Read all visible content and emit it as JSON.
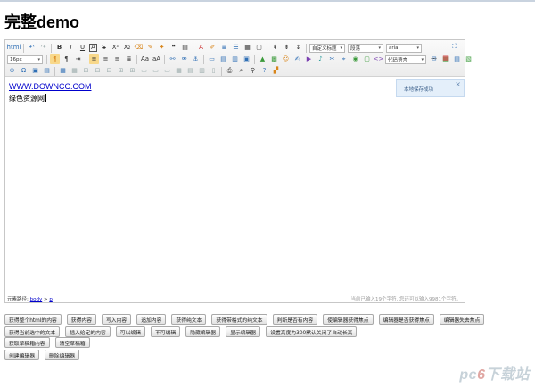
{
  "page": {
    "title": "完整demo"
  },
  "toolbar": {
    "row1_icons": [
      "source-icon",
      "undo-icon",
      "redo-icon",
      "bold-icon",
      "italic-icon",
      "underline-icon",
      "fontborder-icon",
      "strikethrough-icon",
      "superscript-icon",
      "subscript-icon",
      "removeformat-icon",
      "formatmatch-icon",
      "autotypeset-icon",
      "blockquote-icon",
      "pasteplain-icon",
      "forecolor-icon",
      "backcolor-icon",
      "insertorderedlist-icon",
      "insertunorderedlist-icon",
      "selectall-icon",
      "cleardoc-icon",
      "rowspacingtop-icon",
      "rowspacingbottom-icon",
      "lineheight-icon"
    ],
    "row1_glyphs": {
      "source": "html",
      "undo": "↶",
      "redo": "↷",
      "bold": "B",
      "italic": "I",
      "underline": "U",
      "fontborder": "A",
      "strikethrough": "S",
      "superscript": "X²",
      "subscript": "X₂",
      "removeformat": "⌫",
      "formatmatch": "✎",
      "autotypeset": "✦",
      "blockquote": "❝",
      "pasteplain": "▤",
      "forecolor": "A",
      "backcolor": "✐",
      "orderedlist": "≣",
      "unorderedlist": "☰",
      "selectall": "▦",
      "cleardoc": "▢",
      "rowspacingtop": "⇞",
      "rowspacingbottom": "⇟",
      "lineheight": "↕"
    },
    "customstyle_value": "自定义标题",
    "paragraph_value": "段落",
    "fontfamily_value": "arial",
    "fontsize_value": "16px",
    "insertcode_value": "代码语言",
    "fullscreen_glyph": "⛶"
  },
  "editor": {
    "link_text": "WWW.DOWNCC.COM",
    "body_text": "绿色资源网",
    "tip_text": "本地保存成功",
    "tip_close": "×",
    "path_label": "元素路径:",
    "path_items": [
      "body",
      "p"
    ],
    "path_sep": ">",
    "wordcount": "当前已输入19个字符, 您还可以输入9981个字符。"
  },
  "buttons": {
    "row1": [
      "获得整个html的内容",
      "获得内容",
      "写入内容",
      "追加内容",
      "获得纯文本",
      "获得带格式的纯文本",
      "判断是否有内容",
      "使编辑器获得焦点",
      "编辑器是否获得焦点",
      "编辑器失去焦点"
    ],
    "row1b": [
      "获得当前选中的文本",
      "插入给定的内容",
      "可以编辑",
      "不可编辑",
      "隐藏编辑器",
      "显示编辑器",
      "设置高度为300默认关闭了自动长高"
    ],
    "row2": [
      "获取草稿箱内容",
      "清空草稿箱"
    ],
    "row3": [
      "创建编辑器",
      "删除编辑器"
    ]
  },
  "watermark": {
    "pre": "pc",
    "six": "6",
    "post": "下载站"
  }
}
